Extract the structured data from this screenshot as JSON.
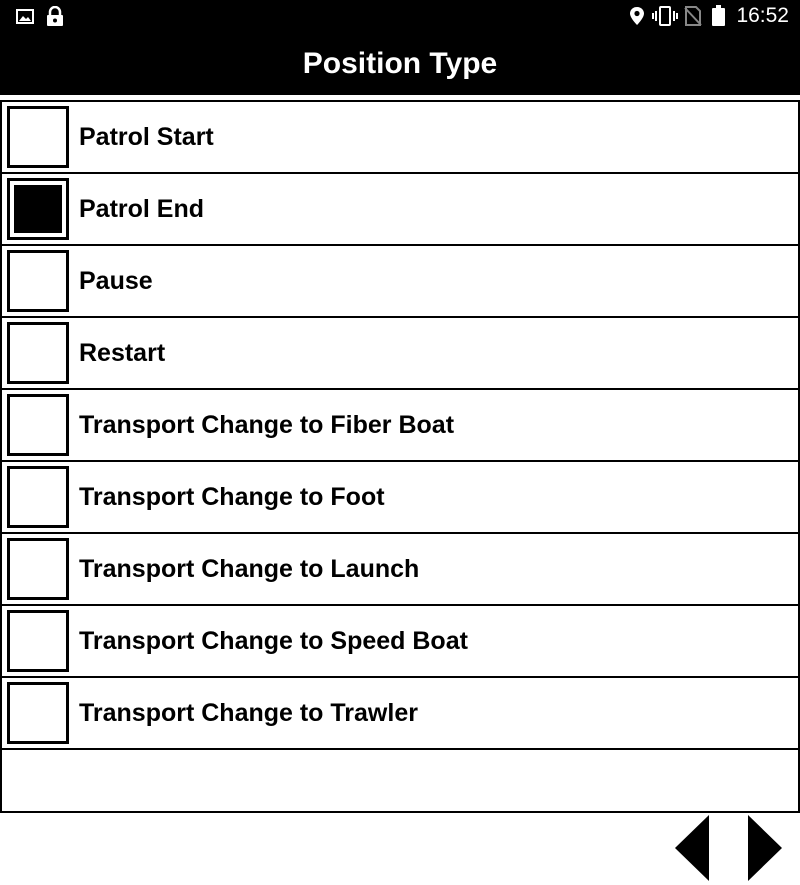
{
  "status_bar": {
    "time": "16:52",
    "left_icons": [
      "image-icon",
      "lock-icon"
    ],
    "right_icons": [
      "location-icon",
      "vibrate-icon",
      "no-sim-icon",
      "battery-icon"
    ]
  },
  "header": {
    "title": "Position Type"
  },
  "options": [
    {
      "label": "Patrol Start",
      "checked": false
    },
    {
      "label": "Patrol End",
      "checked": true
    },
    {
      "label": "Pause",
      "checked": false
    },
    {
      "label": "Restart",
      "checked": false
    },
    {
      "label": "Transport Change to Fiber Boat",
      "checked": false
    },
    {
      "label": "Transport Change to Foot",
      "checked": false
    },
    {
      "label": "Transport Change to Launch",
      "checked": false
    },
    {
      "label": "Transport Change to Speed Boat",
      "checked": false
    },
    {
      "label": "Transport Change to Trawler",
      "checked": false
    }
  ],
  "navigation": {
    "prev_icon": "arrow-left-icon",
    "next_icon": "arrow-right-icon"
  }
}
